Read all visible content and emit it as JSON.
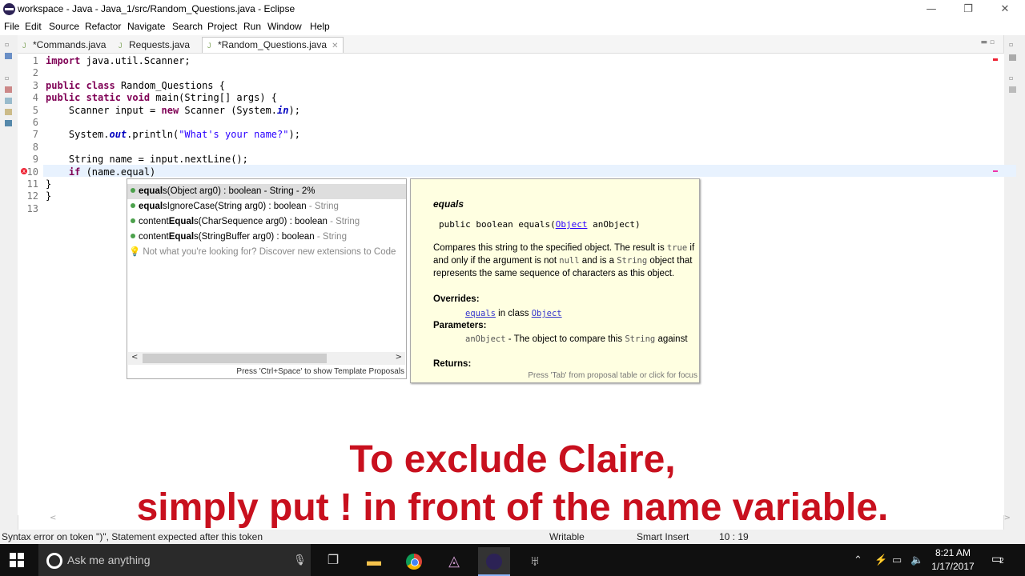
{
  "window": {
    "title": "workspace - Java - Java_1/src/Random_Questions.java - Eclipse",
    "minimize": "—",
    "restore": "❐",
    "close": "✕"
  },
  "menu": [
    "File",
    "Edit",
    "Source",
    "Refactor",
    "Navigate",
    "Search",
    "Project",
    "Run",
    "Window",
    "Help"
  ],
  "tabs": [
    {
      "label": "*Commands.java"
    },
    {
      "label": "Requests.java"
    },
    {
      "label": "*Random_Questions.java",
      "close": "✕"
    }
  ],
  "code": [
    {
      "n": "1",
      "segs": [
        [
          "kw",
          "import"
        ],
        [
          "",
          "java.util.Scanner;"
        ]
      ]
    },
    {
      "n": "2",
      "segs": []
    },
    {
      "n": "3",
      "segs": [
        [
          "kw",
          "public class"
        ],
        [
          "",
          "Random_Questions {"
        ]
      ]
    },
    {
      "n": "4",
      "segs": [
        [
          "kw",
          "public static void"
        ],
        [
          "",
          "main(String[] args) {"
        ]
      ]
    },
    {
      "n": "5",
      "segs": [
        [
          "",
          "    Scanner input = "
        ],
        [
          "kw",
          "new"
        ],
        [
          "",
          " Scanner (System."
        ],
        [
          "fld",
          "in"
        ],
        [
          "",
          ");"
        ]
      ]
    },
    {
      "n": "6",
      "segs": []
    },
    {
      "n": "7",
      "segs": [
        [
          "",
          "    System."
        ],
        [
          "fld",
          "out"
        ],
        [
          "",
          ".println("
        ],
        [
          "str",
          "\"What's your name?\""
        ],
        [
          "",
          ");"
        ]
      ]
    },
    {
      "n": "8",
      "segs": []
    },
    {
      "n": "9",
      "segs": [
        [
          "",
          "    String name = input.nextLine();"
        ]
      ]
    },
    {
      "n": "10",
      "segs": [
        [
          "",
          "    "
        ],
        [
          "kw",
          "if"
        ],
        [
          "",
          " (name.equal)"
        ]
      ]
    },
    {
      "n": "11",
      "segs": [
        [
          "",
          "}"
        ]
      ]
    },
    {
      "n": "12",
      "segs": [
        [
          "",
          "}"
        ]
      ]
    },
    {
      "n": "13",
      "segs": []
    }
  ],
  "proposals": [
    {
      "bold": "equal",
      "rest": "s(Object arg0) : boolean - String - 2%",
      "grey": ""
    },
    {
      "bold": "equal",
      "rest": "sIgnoreCase(String arg0) : boolean",
      "grey": " - String"
    },
    {
      "pre": "content",
      "bold": "Equal",
      "rest": "s(CharSequence arg0) : boolean",
      "grey": " - String"
    },
    {
      "pre": "content",
      "bold": "Equal",
      "rest": "s(StringBuffer arg0) : boolean",
      "grey": " - String"
    }
  ],
  "proposal_hint": "Not what you're looking for? Discover new extensions to Code",
  "proposal_footer": "Press 'Ctrl+Space' to show Template Proposals",
  "doc": {
    "title": "equals",
    "sig_pre": "public boolean equals(",
    "sig_link": "Object",
    "sig_post": " anObject)",
    "desc1": "Compares this string to the specified object. The result is ",
    "desc_true": "true",
    "desc2": " if and only if the argument is not ",
    "desc_null": "null",
    "desc3": " and is a ",
    "desc_string": "String",
    "desc4": " object that represents the same sequence of characters as this object.",
    "overrides_h": "Overrides:",
    "overrides_link": "equals",
    "overrides_mid": " in class ",
    "overrides_cls": "Object",
    "params_h": "Parameters:",
    "param_name": "anObject",
    "param_text1": " - The object to compare this ",
    "param_string": "String",
    "param_text2": " against",
    "returns_h": "Returns:",
    "footer": "Press 'Tab' from proposal table or click for focus"
  },
  "overlay": {
    "line1": "To exclude Claire,",
    "line2": "simply put ! in front of the name variable."
  },
  "status": {
    "error": "Syntax error on token \")\", Statement expected after this token",
    "writable": "Writable",
    "insert": "Smart Insert",
    "position": "10 : 19"
  },
  "taskbar": {
    "search_placeholder": "Ask me anything",
    "time": "8:21 AM",
    "date": "1/17/2017",
    "notifications": "2"
  }
}
